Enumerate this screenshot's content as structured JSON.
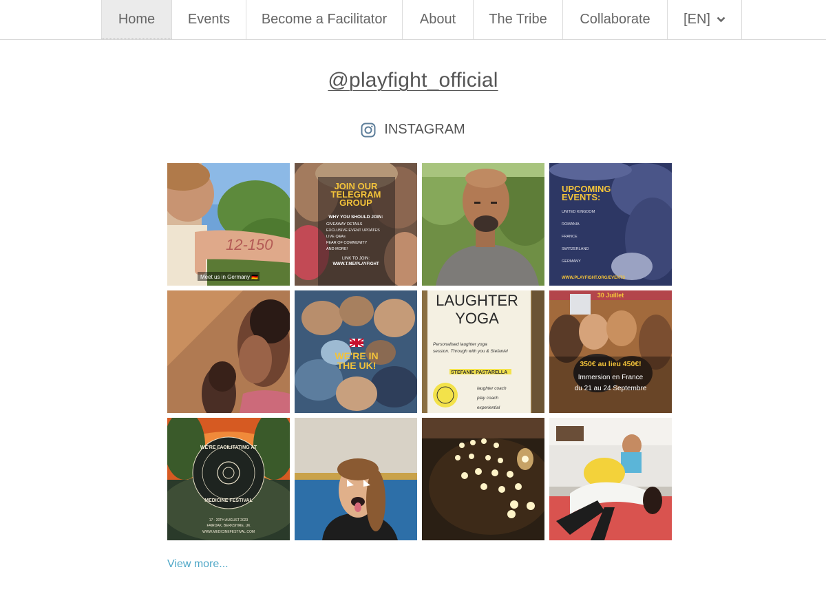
{
  "nav": {
    "items": [
      {
        "label": "Home",
        "active": true
      },
      {
        "label": "Events"
      },
      {
        "label": "Become a Facilitator"
      },
      {
        "label": "About"
      },
      {
        "label": "The Tribe"
      },
      {
        "label": "Collaborate"
      }
    ],
    "language": "[EN]"
  },
  "profile": {
    "handle": "@playfight_official",
    "network": "INSTAGRAM",
    "network_icon": "instagram-icon"
  },
  "posts": {
    "p1": {
      "overlay": "12-150",
      "caption": "Meet us in Germany 🇩🇪"
    },
    "p2": {
      "title": [
        "JOIN OUR",
        "TELEGRAM",
        "GROUP"
      ],
      "subtitle": "WHY YOU SHOULD JOIN:",
      "bullets": [
        "GIVEAWAY DETAILS",
        "EXCLUSIVE EVENT UPDATES",
        "LIVE Q&As",
        "FEAR OF COMMUNITY",
        "AND MORE!"
      ],
      "cta": [
        "LINK TO JOIN:",
        "WWW.T.ME/PLAYFIGHT"
      ]
    },
    "p4": {
      "title": [
        "UPCOMING",
        "EVENTS:"
      ],
      "lines": [
        "UNITED KINGDOM",
        "ROMANIA",
        "FRANCE",
        "SWITZERLAND",
        "GERMANY"
      ],
      "footer": "WWW.PLAYFIGHT.ORG/EVENTS"
    },
    "p6": {
      "title": [
        "WE'RE IN",
        "THE UK!"
      ]
    },
    "p7": {
      "title": [
        "LAUGHTER",
        "YOGA"
      ],
      "sub": [
        "Personalised laughter yoga",
        "session. Through with you & Stefanie!"
      ],
      "name": "STEFANIE PASTARELLA",
      "notes": [
        "laughter coach",
        "play coach",
        "experiential"
      ]
    },
    "p8": {
      "top": "30 Juillet",
      "price": "350€ au lieu 450€!",
      "line1": "Immersion en France",
      "line2": "du 21 au 24 Septembre"
    },
    "p9": {
      "ring_top": "WE'RE FACILITATING AT",
      "ring_bottom": "MEDICINE FESTIVAL",
      "dates": "17 - 20TH AUGUST 2023",
      "place": "FAIROAK, BERKSHIRE, UK",
      "url": "WWW.MEDICINEFESTIVAL.COM"
    }
  },
  "view_more": "View more..."
}
